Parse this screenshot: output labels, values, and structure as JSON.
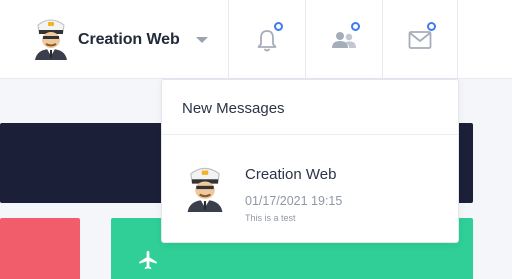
{
  "header": {
    "user_name": "Creation Web",
    "icons": [
      "bell-icon",
      "users-icon",
      "mail-icon"
    ],
    "accent": "#3d7bf0"
  },
  "dashboard": {
    "panel_color": "#1b2038",
    "card_colors": [
      "#f25d6b",
      "#2fcf97"
    ],
    "card_icon": "plane-icon"
  },
  "messages_dropdown": {
    "title": "New Messages",
    "items": [
      {
        "sender": "Creation Web",
        "time": "01/17/2021 19:15",
        "preview": "This is a test"
      }
    ]
  }
}
